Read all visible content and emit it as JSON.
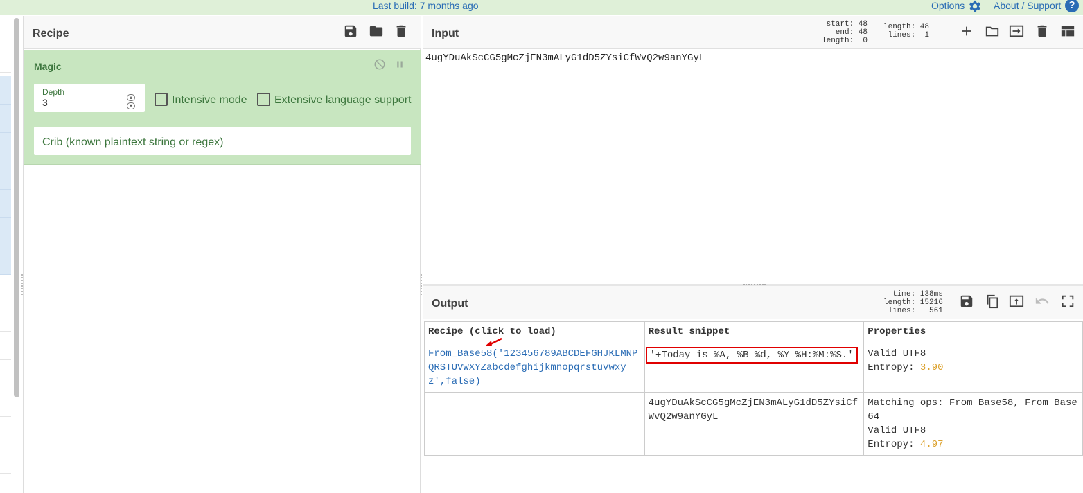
{
  "topbar": {
    "build": "Last build: 7 months ago",
    "options": "Options",
    "about": "About / Support",
    "help": "?"
  },
  "recipe": {
    "title": "Recipe",
    "operation": {
      "name": "Magic",
      "depth_label": "Depth",
      "depth_value": "3",
      "intensive_label": "Intensive mode",
      "intensive_checked": false,
      "extensive_label": "Extensive language support",
      "extensive_checked": false,
      "crib_placeholder": "Crib (known plaintext string or regex)"
    }
  },
  "input": {
    "title": "Input",
    "stats_left": "start: 48\n  end: 48\nlength:  0",
    "stats_right": "length: 48\n lines:  1",
    "text": "4ugYDuAkScCG5gMcZjEN3mALyG1dD5ZYsiCfWvQ2w9anYGyL"
  },
  "output": {
    "title": "Output",
    "stats": "  time: 138ms\nlength: 15216\n lines:   561",
    "table": {
      "headers": [
        "Recipe (click to load)",
        "Result snippet",
        "Properties"
      ],
      "rows": [
        {
          "recipe": "From_Base58('123456789ABCDEFGHJKLMNPQRSTUVWXYZabcdefghijkmnopqrstuvwxyz',false)",
          "snippet": "'+Today is %A, %B %d, %Y %H:%M:%S.'",
          "prop_line1": "Valid UTF8",
          "entropy_label": "Entropy: ",
          "entropy_value": "3.90"
        },
        {
          "recipe": "",
          "snippet": "4ugYDuAkScCG5gMcZjEN3mALyG1dD5ZYsiCfWvQ2w9anYGyL",
          "prop_line0": "Matching ops: From Base58, From Base64",
          "prop_line1": "Valid UTF8",
          "entropy_label": "Entropy: ",
          "entropy_value": "4.97"
        }
      ]
    }
  },
  "colors": {
    "accent": "#2a6cb5",
    "operation_bg": "#c8e6c0",
    "operation_text": "#3c763d",
    "entropy": "#dca22e",
    "highlight": "#e00000"
  }
}
